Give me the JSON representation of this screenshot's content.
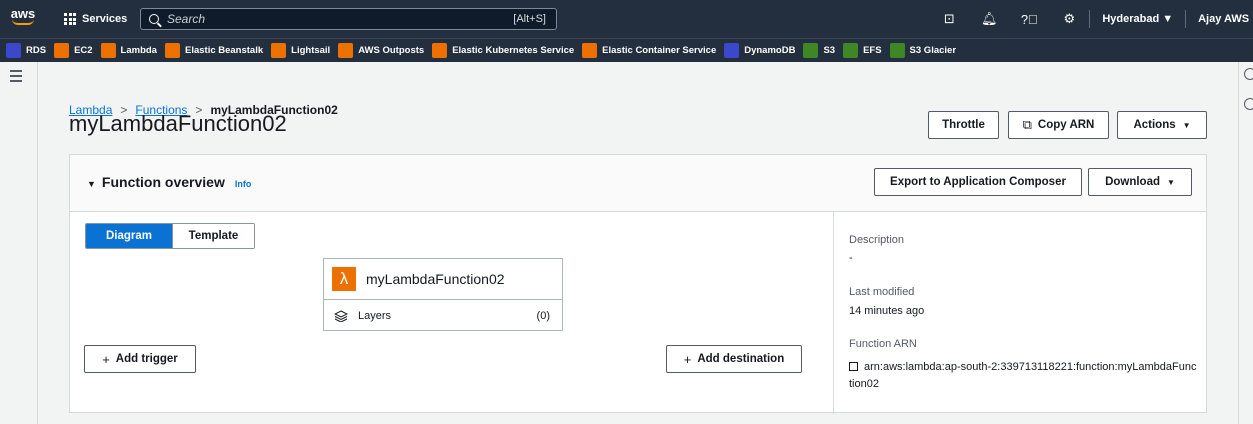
{
  "topnav": {
    "logo": "aws",
    "services_label": "Services",
    "search_placeholder": "Search",
    "search_shortcut": "[Alt+S]",
    "region": "Hyderabad ▼",
    "user": "Ajay AWS ▼",
    "icons": [
      "cloudshell-icon",
      "bell-icon",
      "help-icon",
      "gear-icon"
    ]
  },
  "favorites": [
    {
      "label": "RDS",
      "color": "#3b48cc",
      "icon": "rds-icon"
    },
    {
      "label": "EC2",
      "color": "#ed7100",
      "icon": "ec2-icon"
    },
    {
      "label": "Lambda",
      "color": "#ed7100",
      "icon": "lambda-icon"
    },
    {
      "label": "Elastic Beanstalk",
      "color": "#ed7100",
      "icon": "beanstalk-icon"
    },
    {
      "label": "Lightsail",
      "color": "#ed7100",
      "icon": "lightsail-icon"
    },
    {
      "label": "AWS Outposts",
      "color": "#ed7100",
      "icon": "outposts-icon"
    },
    {
      "label": "Elastic Kubernetes Service",
      "color": "#ed7100",
      "icon": "eks-icon"
    },
    {
      "label": "Elastic Container Service",
      "color": "#ed7100",
      "icon": "ecs-icon"
    },
    {
      "label": "DynamoDB",
      "color": "#3b48cc",
      "icon": "dynamodb-icon"
    },
    {
      "label": "S3",
      "color": "#3f8624",
      "icon": "s3-icon"
    },
    {
      "label": "EFS",
      "color": "#3f8624",
      "icon": "efs-icon"
    },
    {
      "label": "S3 Glacier",
      "color": "#3f8624",
      "icon": "glacier-icon"
    }
  ],
  "breadcrumb": {
    "root": "Lambda",
    "functions": "Functions",
    "current": "myLambdaFunction02"
  },
  "page": {
    "title": "myLambdaFunction02",
    "throttle": "Throttle",
    "copy_arn": "Copy ARN",
    "actions": "Actions"
  },
  "overview": {
    "title": "Function overview",
    "info": "Info",
    "export": "Export to Application Composer",
    "download": "Download",
    "tab_diagram": "Diagram",
    "tab_template": "Template",
    "function_name": "myLambdaFunction02",
    "layers_label": "Layers",
    "layers_count": "(0)",
    "add_trigger": "Add trigger",
    "add_destination": "Add destination"
  },
  "details": {
    "description_label": "Description",
    "description_value": "-",
    "last_modified_label": "Last modified",
    "last_modified_value": "14 minutes ago",
    "arn_label": "Function ARN",
    "arn_value": "arn:aws:lambda:ap-south-2:339713118221:function:myLambdaFunction02"
  }
}
